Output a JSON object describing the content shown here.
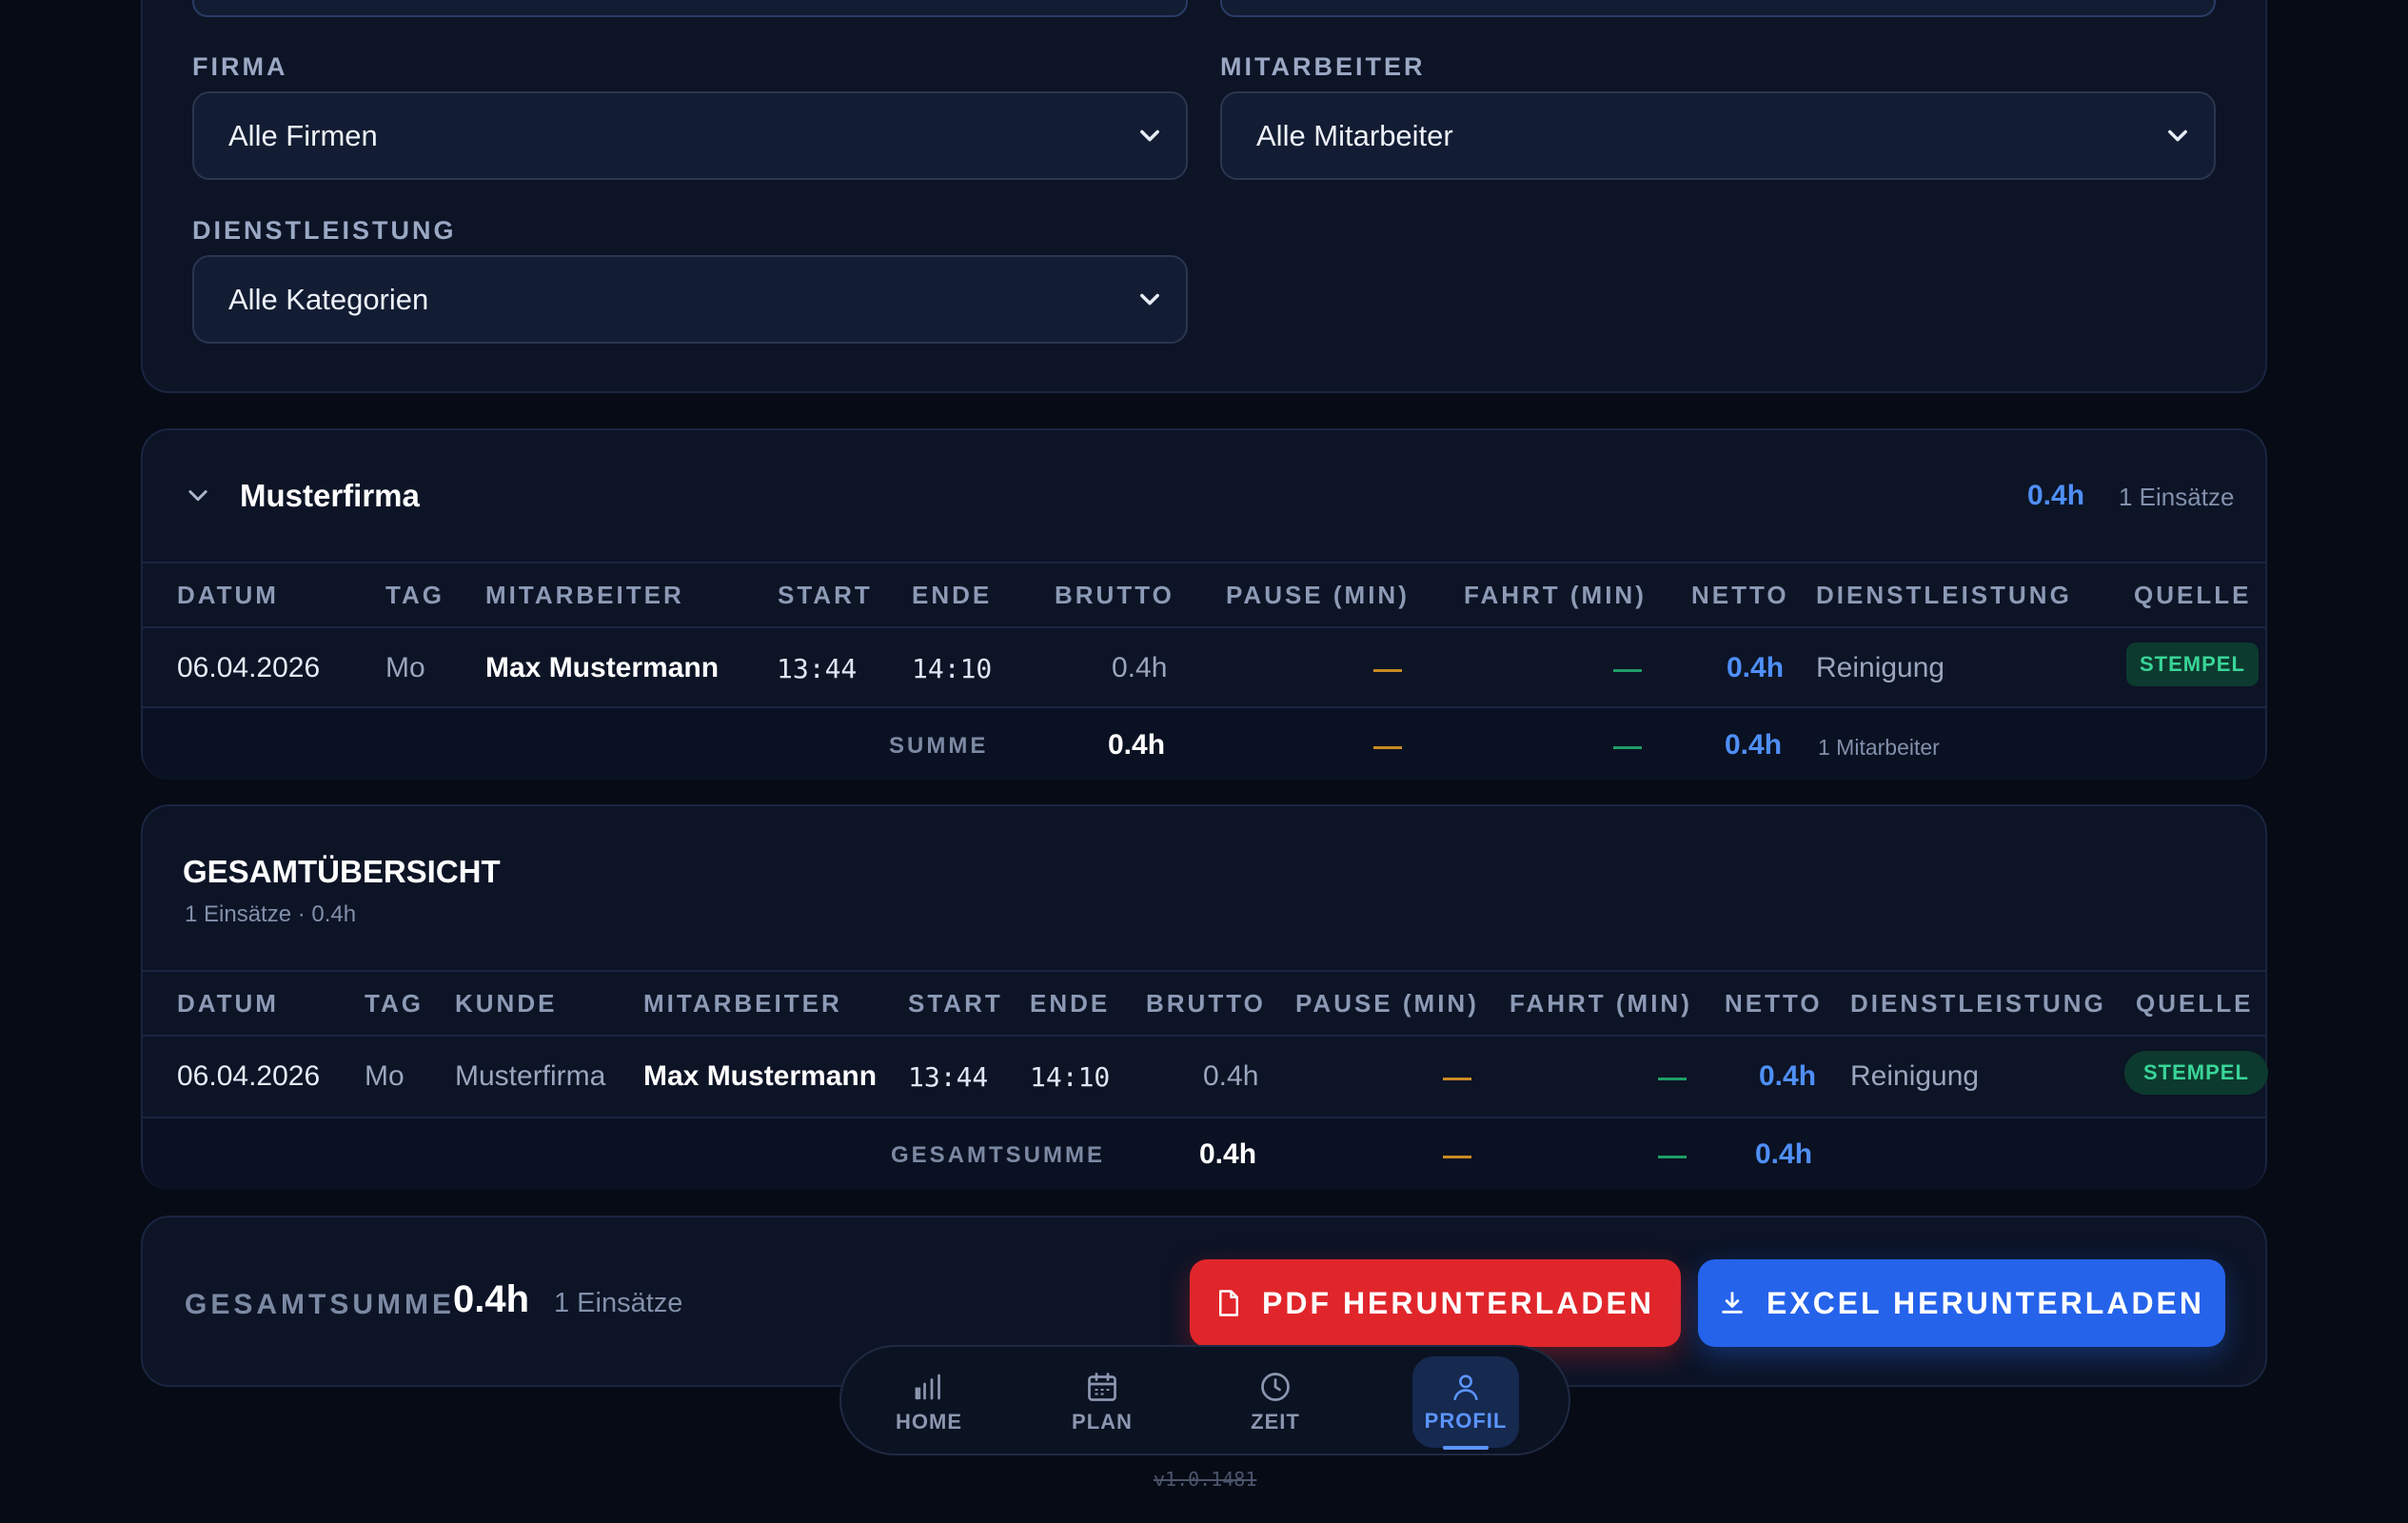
{
  "filters": {
    "firma_label": "FIRMA",
    "firma_value": "Alle Firmen",
    "mitarbeiter_label": "MITARBEITER",
    "mitarbeiter_value": "Alle Mitarbeiter",
    "dienstleistung_label": "DIENSTLEISTUNG",
    "dienstleistung_value": "Alle Kategorien"
  },
  "group": {
    "name": "Musterfirma",
    "total": "0.4h",
    "count": "1 Einsätze",
    "columns": [
      "DATUM",
      "TAG",
      "MITARBEITER",
      "START",
      "ENDE",
      "BRUTTO",
      "PAUSE (MIN)",
      "FAHRT (MIN)",
      "NETTO",
      "DIENSTLEISTUNG",
      "QUELLE"
    ],
    "rows": [
      {
        "datum": "06.04.2026",
        "tag": "Mo",
        "mitarbeiter": "Max Mustermann",
        "start": "13:44",
        "ende": "14:10",
        "brutto": "0.4h",
        "netto": "0.4h",
        "dienstleistung": "Reinigung",
        "quelle": "STEMPEL"
      }
    ],
    "sum_label": "SUMME",
    "sum_brutto": "0.4h",
    "sum_netto": "0.4h",
    "sum_note": "1 Mitarbeiter"
  },
  "overview": {
    "title": "GESAMTÜBERSICHT",
    "subtitle": "1 Einsätze · 0.4h",
    "columns": [
      "DATUM",
      "TAG",
      "KUNDE",
      "MITARBEITER",
      "START",
      "ENDE",
      "BRUTTO",
      "PAUSE (MIN)",
      "FAHRT (MIN)",
      "NETTO",
      "DIENSTLEISTUNG",
      "QUELLE"
    ],
    "rows": [
      {
        "datum": "06.04.2026",
        "tag": "Mo",
        "kunde": "Musterfirma",
        "mitarbeiter": "Max Mustermann",
        "start": "13:44",
        "ende": "14:10",
        "brutto": "0.4h",
        "netto": "0.4h",
        "dienstleistung": "Reinigung",
        "quelle": "STEMPEL"
      }
    ],
    "sum_label": "GESAMTSUMME",
    "sum_brutto": "0.4h",
    "sum_netto": "0.4h"
  },
  "footer": {
    "label": "GESAMTSUMME",
    "total": "0.4h",
    "count": "1 Einsätze",
    "pdf_button": "PDF HERUNTERLADEN",
    "excel_button": "EXCEL HERUNTERLADEN"
  },
  "nav": {
    "items": [
      {
        "label": "HOME",
        "icon": "bar-chart-icon"
      },
      {
        "label": "PLAN",
        "icon": "calendar-icon"
      },
      {
        "label": "ZEIT",
        "icon": "clock-icon"
      },
      {
        "label": "PROFIL",
        "icon": "user-icon",
        "active": true
      }
    ]
  },
  "version": "v1.0.1481",
  "colors": {
    "accent_blue": "#4f8ff7",
    "pdf_red": "#e0262b",
    "excel_blue": "#2563eb",
    "badge_green": "#39d598",
    "pause_orange": "#c98a21",
    "fahrt_green": "#1f9d66"
  }
}
